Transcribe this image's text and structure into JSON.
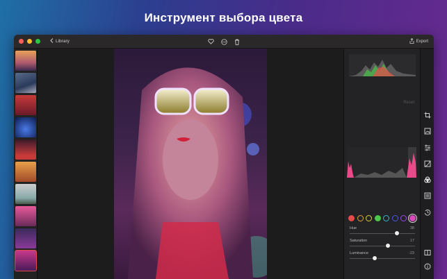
{
  "headline": "Инструмент выбора цвета",
  "titlebar": {
    "back_label": "Library",
    "export_label": "Export"
  },
  "panel": {
    "reset_label": "Reset",
    "sliders": [
      {
        "label": "Hue",
        "value": "38",
        "fraction": 0.72
      },
      {
        "label": "Saturation",
        "value": "17",
        "fraction": 0.58
      },
      {
        "label": "Luminance",
        "value": "-23",
        "fraction": 0.38
      }
    ],
    "swatches": [
      {
        "name": "red",
        "color": "#e84a4a",
        "filled": true
      },
      {
        "name": "orange",
        "color": "#e8a23a",
        "filled": false
      },
      {
        "name": "yellow",
        "color": "#d8d23a",
        "filled": false
      },
      {
        "name": "green",
        "color": "#4ac84a",
        "filled": true
      },
      {
        "name": "aqua",
        "color": "#3ab8d8",
        "filled": false
      },
      {
        "name": "blue",
        "color": "#4a5ae8",
        "filled": false
      },
      {
        "name": "purple",
        "color": "#9a4ae8",
        "filled": false
      },
      {
        "name": "magenta",
        "color": "#d84ab8",
        "filled": true,
        "active": true
      }
    ]
  },
  "colors": {
    "accent": "#e04b4b",
    "window_bg": "#1b1b1d"
  }
}
